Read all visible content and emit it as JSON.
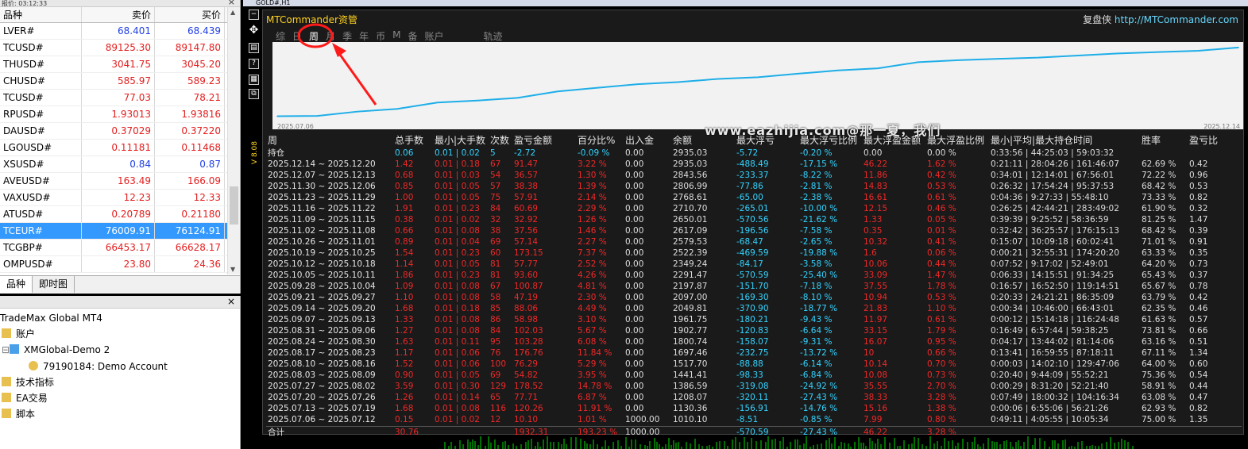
{
  "market_watch": {
    "title": "报价: 03:12:33",
    "columns": [
      "品种",
      "卖价",
      "买价"
    ],
    "rows": [
      {
        "symbol": "LVER#",
        "bid": "68.401",
        "ask": "68.439",
        "color": "blue"
      },
      {
        "symbol": "TCUSD#",
        "bid": "89125.30",
        "ask": "89147.80",
        "color": "red"
      },
      {
        "symbol": "THUSD#",
        "bid": "3041.75",
        "ask": "3045.20",
        "color": "red"
      },
      {
        "symbol": "CHUSD#",
        "bid": "585.97",
        "ask": "589.23",
        "color": "red"
      },
      {
        "symbol": "TCUSD#",
        "bid": "77.03",
        "ask": "78.21",
        "color": "red"
      },
      {
        "symbol": "RPUSD#",
        "bid": "1.93013",
        "ask": "1.93816",
        "color": "red"
      },
      {
        "symbol": "DAUSD#",
        "bid": "0.37029",
        "ask": "0.37220",
        "color": "red"
      },
      {
        "symbol": "LGOUSD#",
        "bid": "0.11181",
        "ask": "0.11468",
        "color": "red"
      },
      {
        "symbol": "XSUSD#",
        "bid": "0.84",
        "ask": "0.87",
        "color": "blue"
      },
      {
        "symbol": "AVEUSD#",
        "bid": "163.49",
        "ask": "166.09",
        "color": "red"
      },
      {
        "symbol": "VAXUSD#",
        "bid": "12.23",
        "ask": "12.33",
        "color": "red"
      },
      {
        "symbol": "ATUSD#",
        "bid": "0.20789",
        "ask": "0.21180",
        "color": "red"
      },
      {
        "symbol": "TCEUR#",
        "bid": "76009.91",
        "ask": "76124.91",
        "color": "selected"
      },
      {
        "symbol": "TCGBP#",
        "bid": "66453.17",
        "ask": "66628.17",
        "color": "red"
      },
      {
        "symbol": "OMPUSD#",
        "bid": "23.80",
        "ask": "24.36",
        "color": "red"
      }
    ],
    "tabs": [
      "品种",
      "即时图"
    ]
  },
  "navigator": {
    "items": [
      "TradeMax Global MT4",
      "账户",
      "XMGlobal-Demo 2",
      "79190184: Demo Account",
      "技术指标",
      "EA交易",
      "脚本"
    ]
  },
  "chart_window": {
    "title": "GOLD#,H1",
    "side_label": "V 8.08"
  },
  "panel": {
    "title": "MTCommander资管",
    "link_prefix": "复盘侠",
    "link": "http://MTCommander.com",
    "tabs": [
      "综",
      "日",
      "周",
      "月",
      "季",
      "年",
      "币",
      "M",
      "备",
      "账户",
      "轨迹"
    ],
    "chart_start": "2025.07.06",
    "chart_end": "2025.12.14",
    "watermark": "www.eazhijia.com@那一夏，我们",
    "columns": [
      "周",
      "总手数",
      "最小|大手数",
      "次数",
      "盈亏金额",
      "百分比%",
      "出入金",
      "余额",
      "最大浮亏",
      "最大浮亏比例",
      "最大浮盈金额",
      "最大浮盈比例",
      "最小|平均|最大持仓时间",
      "胜率",
      "盈亏比"
    ],
    "open_row": [
      "持仓",
      "0.06",
      "0.01 | 0.02",
      "5",
      "-2.72",
      "-0.09 %",
      "0.00",
      "2935.03",
      "-5.72",
      "-0.20 %",
      "0.00",
      "0.00 %",
      "0:33:56 | 44:25:03 | 59:03:32",
      "",
      ""
    ],
    "rows": [
      [
        "2025.12.14 ~ 2025.12.20",
        "1.42",
        "0.01 | 0.18",
        "67",
        "91.47",
        "3.22 %",
        "0.00",
        "2935.03",
        "-488.49",
        "-17.15 %",
        "46.22",
        "1.62 %",
        "0:21:11 | 28:04:26 | 161:46:07",
        "62.69 %",
        "0.42"
      ],
      [
        "2025.12.07 ~ 2025.12.13",
        "0.68",
        "0.01 | 0.03",
        "54",
        "36.57",
        "1.30 %",
        "0.00",
        "2843.56",
        "-233.37",
        "-8.22 %",
        "11.86",
        "0.42 %",
        "0:34:01 | 12:14:01 | 67:56:01",
        "72.22 %",
        "0.96"
      ],
      [
        "2025.11.30 ~ 2025.12.06",
        "0.85",
        "0.01 | 0.05",
        "57",
        "38.38",
        "1.39 %",
        "0.00",
        "2806.99",
        "-77.86",
        "-2.81 %",
        "14.83",
        "0.53 %",
        "0:26:32 | 17:54:24 | 95:37:53",
        "68.42 %",
        "0.53"
      ],
      [
        "2025.11.23 ~ 2025.11.29",
        "1.00",
        "0.01 | 0.05",
        "75",
        "57.91",
        "2.14 %",
        "0.00",
        "2768.61",
        "-65.00",
        "-2.38 %",
        "16.61",
        "0.61 %",
        "0:04:36 | 9:27:33 | 55:48:10",
        "73.33 %",
        "0.82"
      ],
      [
        "2025.11.16 ~ 2025.11.22",
        "1.91",
        "0.01 | 0.23",
        "84",
        "60.69",
        "2.29 %",
        "0.00",
        "2710.70",
        "-265.01",
        "-10.00 %",
        "12.15",
        "0.46 %",
        "0:26:25 | 42:44:21 | 283:49:02",
        "61.90 %",
        "0.32"
      ],
      [
        "2025.11.09 ~ 2025.11.15",
        "0.38",
        "0.01 | 0.02",
        "32",
        "32.92",
        "1.26 %",
        "0.00",
        "2650.01",
        "-570.56",
        "-21.62 %",
        "1.33",
        "0.05 %",
        "0:39:39 | 9:25:52 | 58:36:59",
        "81.25 %",
        "1.47"
      ],
      [
        "2025.11.02 ~ 2025.11.08",
        "0.66",
        "0.01 | 0.08",
        "38",
        "37.56",
        "1.46 %",
        "0.00",
        "2617.09",
        "-196.56",
        "-7.58 %",
        "0.35",
        "0.01 %",
        "0:32:42 | 36:25:57 | 176:15:13",
        "68.42 %",
        "0.39"
      ],
      [
        "2025.10.26 ~ 2025.11.01",
        "0.89",
        "0.01 | 0.04",
        "69",
        "57.14",
        "2.27 %",
        "0.00",
        "2579.53",
        "-68.47",
        "-2.65 %",
        "10.32",
        "0.41 %",
        "0:15:07 | 10:09:18 | 60:02:41",
        "71.01 %",
        "0.91"
      ],
      [
        "2025.10.19 ~ 2025.10.25",
        "1.54",
        "0.01 | 0.23",
        "60",
        "173.15",
        "7.37 %",
        "0.00",
        "2522.39",
        "-469.59",
        "-19.88 %",
        "1.6",
        "0.06 %",
        "0:00:21 | 32:55:31 | 174:20:20",
        "63.33 %",
        "0.35"
      ],
      [
        "2025.10.12 ~ 2025.10.18",
        "1.14",
        "0.01 | 0.05",
        "81",
        "57.77",
        "2.52 %",
        "0.00",
        "2349.24",
        "-84.17",
        "-3.58 %",
        "10.06",
        "0.44 %",
        "0:07:52 | 9:17:02 | 52:49:01",
        "64.20 %",
        "0.73"
      ],
      [
        "2025.10.05 ~ 2025.10.11",
        "1.86",
        "0.01 | 0.23",
        "81",
        "93.60",
        "4.26 %",
        "0.00",
        "2291.47",
        "-570.59",
        "-25.40 %",
        "33.09",
        "1.47 %",
        "0:06:33 | 14:15:51 | 91:34:25",
        "65.43 %",
        "0.37"
      ],
      [
        "2025.09.28 ~ 2025.10.04",
        "1.09",
        "0.01 | 0.08",
        "67",
        "100.87",
        "4.81 %",
        "0.00",
        "2197.87",
        "-151.70",
        "-7.18 %",
        "37.55",
        "1.78 %",
        "0:16:57 | 16:52:50 | 119:14:51",
        "65.67 %",
        "0.78"
      ],
      [
        "2025.09.21 ~ 2025.09.27",
        "1.10",
        "0.01 | 0.08",
        "58",
        "47.19",
        "2.30 %",
        "0.00",
        "2097.00",
        "-169.30",
        "-8.10 %",
        "10.94",
        "0.53 %",
        "0:20:33 | 24:21:21 | 86:35:09",
        "63.79 %",
        "0.42"
      ],
      [
        "2025.09.14 ~ 2025.09.20",
        "1.68",
        "0.01 | 0.18",
        "85",
        "88.06",
        "4.49 %",
        "0.00",
        "2049.81",
        "-370.90",
        "-18.77 %",
        "21.83",
        "1.10 %",
        "0:00:34 | 10:46:00 | 66:43:01",
        "62.35 %",
        "0.46"
      ],
      [
        "2025.09.07 ~ 2025.09.13",
        "1.33",
        "0.01 | 0.08",
        "86",
        "58.98",
        "3.10 %",
        "0.00",
        "1961.75",
        "-180.21",
        "-9.43 %",
        "11.97",
        "0.61 %",
        "0:00:12 | 15:14:18 | 116:24:48",
        "61.63 %",
        "0.57"
      ],
      [
        "2025.08.31 ~ 2025.09.06",
        "1.27",
        "0.01 | 0.08",
        "84",
        "102.03",
        "5.67 %",
        "0.00",
        "1902.77",
        "-120.83",
        "-6.64 %",
        "33.15",
        "1.79 %",
        "0:16:49 | 6:57:44 | 59:38:25",
        "73.81 %",
        "0.66"
      ],
      [
        "2025.08.24 ~ 2025.08.30",
        "1.63",
        "0.01 | 0.11",
        "95",
        "103.28",
        "6.08 %",
        "0.00",
        "1800.74",
        "-158.07",
        "-9.31 %",
        "16.07",
        "0.95 %",
        "0:04:17 | 13:44:02 | 81:14:06",
        "63.16 %",
        "0.51"
      ],
      [
        "2025.08.17 ~ 2025.08.23",
        "1.17",
        "0.01 | 0.06",
        "76",
        "176.76",
        "11.84 %",
        "0.00",
        "1697.46",
        "-232.75",
        "-13.72 %",
        "10",
        "0.66 %",
        "0:13:41 | 16:59:55 | 87:18:11",
        "67.11 %",
        "1.34"
      ],
      [
        "2025.08.10 ~ 2025.08.16",
        "1.52",
        "0.01 | 0.06",
        "100",
        "76.29",
        "5.29 %",
        "0.00",
        "1517.70",
        "-88.88",
        "-6.14 %",
        "10.14",
        "0.70 %",
        "0:00:03 | 14:02:10 | 129:47:06",
        "64.00 %",
        "0.60"
      ],
      [
        "2025.08.03 ~ 2025.08.09",
        "0.90",
        "0.01 | 0.05",
        "69",
        "54.82",
        "3.95 %",
        "0.00",
        "1441.41",
        "-98.33",
        "-6.84 %",
        "10.08",
        "0.73 %",
        "0:20:40 | 9:44:09 | 55:52:21",
        "75.36 %",
        "0.54"
      ],
      [
        "2025.07.27 ~ 2025.08.02",
        "3.59",
        "0.01 | 0.30",
        "129",
        "178.52",
        "14.78 %",
        "0.00",
        "1386.59",
        "-319.08",
        "-24.92 %",
        "35.55",
        "2.70 %",
        "0:00:29 | 8:31:20 | 52:21:40",
        "58.91 %",
        "0.44"
      ],
      [
        "2025.07.20 ~ 2025.07.26",
        "1.26",
        "0.01 | 0.14",
        "65",
        "77.71",
        "6.87 %",
        "0.00",
        "1208.07",
        "-320.11",
        "-27.43 %",
        "38.33",
        "3.28 %",
        "0:07:49 | 18:00:32 | 104:16:34",
        "63.08 %",
        "0.47"
      ],
      [
        "2025.07.13 ~ 2025.07.19",
        "1.68",
        "0.01 | 0.08",
        "116",
        "120.26",
        "11.91 %",
        "0.00",
        "1130.36",
        "-156.91",
        "-14.76 %",
        "15.16",
        "1.38 %",
        "0:00:06 | 6:55:06 | 56:21:26",
        "62.93 %",
        "0.82"
      ],
      [
        "2025.07.06 ~ 2025.07.12",
        "0.15",
        "0.01 | 0.02",
        "12",
        "10.10",
        "1.01 %",
        "1000.00",
        "1010.10",
        "-8.51",
        "-0.85 %",
        "7.99",
        "0.80 %",
        "0:49:11 | 4:05:55 | 10:05:34",
        "75.00 %",
        "1.35"
      ]
    ],
    "total_row": [
      "合计",
      "30.76",
      "",
      "",
      "1932.31",
      "193.23 %",
      "1000.00",
      "",
      "-570.59",
      "-27.43 %",
      "46.22",
      "3.28 %",
      "",
      "",
      ""
    ]
  },
  "chart_data": {
    "type": "line",
    "x": [
      "2025.07.06",
      "2025.07.12",
      "2025.07.19",
      "2025.07.26",
      "2025.08.02",
      "2025.08.09",
      "2025.08.16",
      "2025.08.23",
      "2025.08.30",
      "2025.09.06",
      "2025.09.13",
      "2025.09.20",
      "2025.09.27",
      "2025.10.04",
      "2025.10.11",
      "2025.10.18",
      "2025.10.25",
      "2025.11.01",
      "2025.11.08",
      "2025.11.15",
      "2025.11.22",
      "2025.11.29",
      "2025.12.06",
      "2025.12.13",
      "2025.12.20"
    ],
    "values": [
      1000,
      1010.1,
      1130.36,
      1208.07,
      1386.59,
      1441.41,
      1517.7,
      1697.46,
      1800.74,
      1902.77,
      1961.75,
      2049.81,
      2097.0,
      2197.87,
      2291.47,
      2349.24,
      2522.39,
      2579.53,
      2617.09,
      2650.01,
      2710.7,
      2768.61,
      2806.99,
      2843.56,
      2935.03
    ],
    "ylim": [
      900,
      3000
    ],
    "color": "#1eaee8",
    "grid": false
  },
  "colors": {
    "cyan": "#33d4ff",
    "red": "#f02828",
    "yellow": "#ffd21e",
    "select": "#3399ff"
  }
}
